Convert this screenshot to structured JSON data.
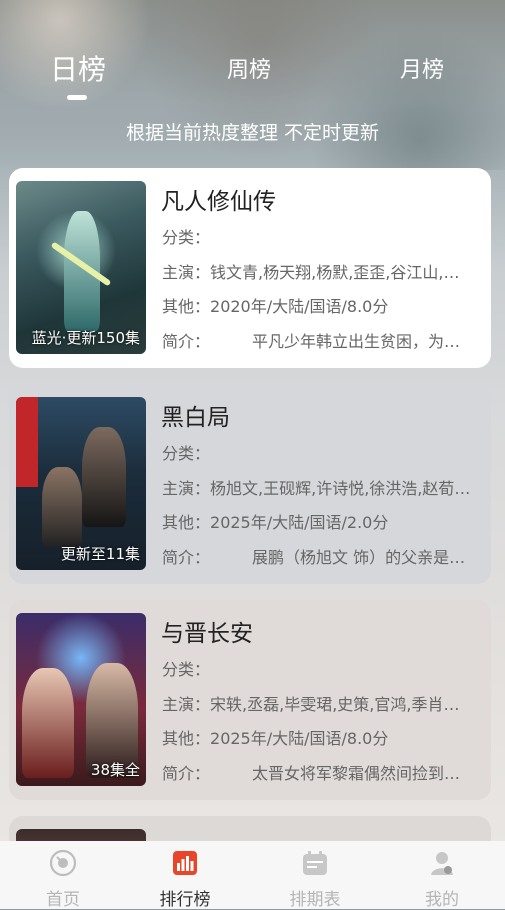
{
  "tabs": [
    {
      "label": "日榜"
    },
    {
      "label": "周榜"
    },
    {
      "label": "月榜"
    }
  ],
  "subtitle": "根据当前热度整理 不定时更新",
  "field_labels": {
    "category": "分类：",
    "cast": "主演：",
    "other": "其他：",
    "intro": "简介："
  },
  "items": [
    {
      "title": "凡人修仙传",
      "category": "",
      "cast": "钱文青,杨天翔,杨默,歪歪,谷江山,…",
      "other": "2020年/大陆/国语/8.0分",
      "intro": "平凡少年韩立出生贫困，为…",
      "badge": "蓝光·更新150集"
    },
    {
      "title": "黑白局",
      "category": "",
      "cast": "杨旭文,王砚辉,许诗悦,徐洪浩,赵荀…",
      "other": "2025年/大陆/国语/2.0分",
      "intro": "展鹏（杨旭文 饰）的父亲是…",
      "badge": "更新至11集"
    },
    {
      "title": "与晋长安",
      "category": "",
      "cast": "宋轶,丞磊,毕雯珺,史策,官鸿,季肖…",
      "other": "2025年/大陆/国语/8.0分",
      "intro": "太晋女将军黎霜偶然间捡到…",
      "badge": "38集全"
    }
  ],
  "tabbar": [
    {
      "label": "首页",
      "icon": "home-icon"
    },
    {
      "label": "排行榜",
      "icon": "ranking-icon"
    },
    {
      "label": "排期表",
      "icon": "calendar-icon"
    },
    {
      "label": "我的",
      "icon": "profile-icon"
    }
  ],
  "colors": {
    "accent": "#e8462a",
    "inactive": "#b5b5b5"
  }
}
